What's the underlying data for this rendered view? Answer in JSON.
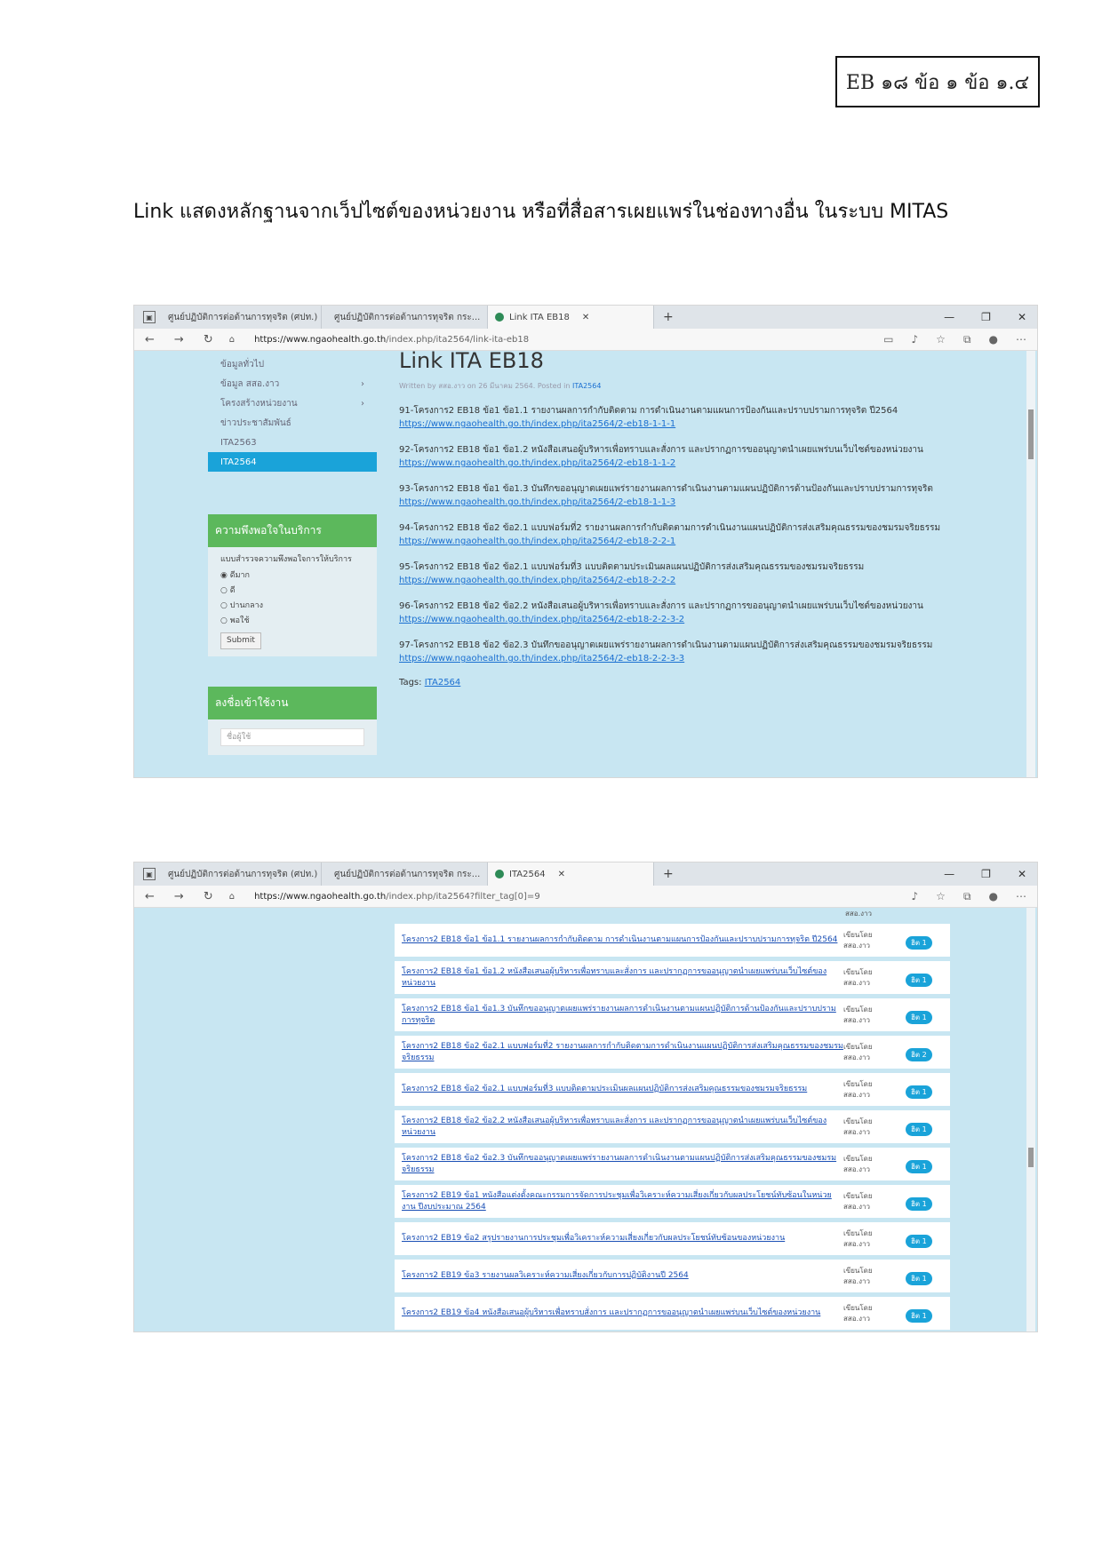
{
  "doc": {
    "ref_box": "EB ๑๘ ข้อ ๑ ข้อ ๑.๔",
    "heading": "Link แสดงหลักฐานจากเว็ปไซต์ของหน่วยงาน หรือที่สื่อสารเผยแพร่ในช่องทางอื่น ในระบบ MITAS"
  },
  "shot1": {
    "tabs": [
      {
        "label": "ศูนย์ปฏิบัติการต่อต้านการทุจริต (ศปท.)"
      },
      {
        "label": "ศูนย์ปฏิบัติการต่อต้านการทุจริต กระ..."
      },
      {
        "label": "Link ITA EB18"
      }
    ],
    "url_host": "https://www.ngaohealth.go.th",
    "url_path": "/index.php/ita2564/link-ita-eb18",
    "sidebar": [
      {
        "label": "ข้อมูลทั่วไป",
        "arrow": ""
      },
      {
        "label": "ข้อมูล สสอ.งาว",
        "arrow": "›"
      },
      {
        "label": "โครงสร้างหน่วยงาน",
        "arrow": "›"
      },
      {
        "label": "ข่าวประชาสัมพันธ์",
        "arrow": ""
      },
      {
        "label": "ITA2563",
        "arrow": ""
      },
      {
        "label": "ITA2564",
        "arrow": ""
      }
    ],
    "survey": {
      "title": "ความพึงพอใจในบริการ",
      "question": "แบบสำรวจความพึงพอใจการให้บริการ",
      "options": [
        "ดีมาก",
        "ดี",
        "ปานกลาง",
        "พอใช้"
      ],
      "submit": "Submit"
    },
    "login": {
      "title": "ลงชื่อเข้าใช้งาน",
      "placeholder": "ชื่อผู้ใช้"
    },
    "page_title": "Link ITA EB18",
    "meta_prefix": "Written by สสอ.งาว on 26 มีนาคม 2564. Posted in",
    "meta_link": "ITA2564",
    "posts": [
      {
        "text": "91-โครงการ2 EB18 ข้อ1 ข้อ1.1 รายงานผลการกำกับติดตาม การดำเนินงานตามแผนการป้องกันและปราบปรามการทุจริต ปี2564",
        "link": "https://www.ngaohealth.go.th/index.php/ita2564/2-eb18-1-1-1"
      },
      {
        "text": "92-โครงการ2 EB18 ข้อ1 ข้อ1.2 หนังสือเสนอผู้บริหารเพื่อทราบและสั่งการ และปรากฏการขออนุญาตนำเผยแพร่บนเว็บไซต์ของหน่วยงาน",
        "link": "https://www.ngaohealth.go.th/index.php/ita2564/2-eb18-1-1-2"
      },
      {
        "text": "93-โครงการ2 EB18 ข้อ1 ข้อ1.3 บันทึกขออนุญาตเผยแพร่รายงานผลการดำเนินงานตามแผนปฏิบัติการด้านป้องกันและปราบปรามการทุจริต",
        "link": "https://www.ngaohealth.go.th/index.php/ita2564/2-eb18-1-1-3"
      },
      {
        "text": "94-โครงการ2 EB18 ข้อ2 ข้อ2.1 แบบฟอร์มที่2 รายงานผลการกำกับติดตามการดำเนินงานแผนปฏิบัติการส่งเสริมคุณธรรมของชมรมจริยธรรม",
        "link": "https://www.ngaohealth.go.th/index.php/ita2564/2-eb18-2-2-1"
      },
      {
        "text": "95-โครงการ2 EB18 ข้อ2 ข้อ2.1 แบบฟอร์มที่3 แบบติดตามประเมินผลแผนปฏิบัติการส่งเสริมคุณธรรมของชมรมจริยธรรม",
        "link": "https://www.ngaohealth.go.th/index.php/ita2564/2-eb18-2-2-2"
      },
      {
        "text": "96-โครงการ2 EB18 ข้อ2 ข้อ2.2 หนังสือเสนอผู้บริหารเพื่อทราบและสั่งการ และปรากฏการขออนุญาตนำเผยแพร่บนเว็บไซต์ของหน่วยงาน",
        "link": "https://www.ngaohealth.go.th/index.php/ita2564/2-eb18-2-2-3-2"
      },
      {
        "text": "97-โครงการ2 EB18 ข้อ2 ข้อ2.3 บันทึกขออนุญาตเผยแพร่รายงานผลการดำเนินงานตามแผนปฏิบัติการส่งเสริมคุณธรรมของชมรมจริยธรรม",
        "link": "https://www.ngaohealth.go.th/index.php/ita2564/2-eb18-2-2-3-3"
      }
    ],
    "tags_label": "Tags:",
    "tags_link": "ITA2564"
  },
  "shot2": {
    "tabs": [
      {
        "label": "ศูนย์ปฏิบัติการต่อต้านการทุจริต (ศปท.)"
      },
      {
        "label": "ศูนย์ปฏิบัติการต่อต้านการทุจริต กระ..."
      },
      {
        "label": "ITA2564"
      }
    ],
    "url_host": "https://www.ngaohealth.go.th",
    "url_path": "/index.php/ita2564?filter_tag[0]=9",
    "top_fragment": "สสอ.งาว",
    "rows": [
      {
        "title": "โครงการ2 EB18 ข้อ1 ข้อ1.1 รายงานผลการกำกับติดตาม การดำเนินงานตามแผนการป้องกันและปราบปรามการทุจริต ปี2564",
        "author_a": "เขียนโดย",
        "author_b": "สสอ.งาว",
        "badge": "ฮิต 1"
      },
      {
        "title": "โครงการ2 EB18 ข้อ1 ข้อ1.2 หนังสือเสนอผู้บริหารเพื่อทราบและสั่งการ และปรากฏการขออนุญาตนำเผยแพร่บนเว็บไซต์ของหน่วยงาน",
        "author_a": "เขียนโดย",
        "author_b": "สสอ.งาว",
        "badge": "ฮิต 1"
      },
      {
        "title": "โครงการ2 EB18 ข้อ1 ข้อ1.3 บันทึกขออนุญาตเผยแพร่รายงานผลการดำเนินงานตามแผนปฏิบัติการด้านป้องกันและปราบปรามการทุจริต",
        "author_a": "เขียนโดย",
        "author_b": "สสอ.งาว",
        "badge": "ฮิต 1"
      },
      {
        "title": "โครงการ2 EB18 ข้อ2 ข้อ2.1 แบบฟอร์มที่2 รายงานผลการกำกับติดตามการดำเนินงานแผนปฏิบัติการส่งเสริมคุณธรรมของชมรมจริยธรรม",
        "author_a": "เขียนโดย",
        "author_b": "สสอ.งาว",
        "badge": "ฮิต 2"
      },
      {
        "title": "โครงการ2 EB18 ข้อ2 ข้อ2.1 แบบฟอร์มที่3 แบบติดตามประเมินผลแผนปฏิบัติการส่งเสริมคุณธรรมของชมรมจริยธรรม",
        "author_a": "เขียนโดย",
        "author_b": "สสอ.งาว",
        "badge": "ฮิต 1"
      },
      {
        "title": "โครงการ2 EB18 ข้อ2 ข้อ2.2 หนังสือเสนอผู้บริหารเพื่อทราบและสั่งการ และปรากฏการขออนุญาตนำเผยแพร่บนเว็บไซต์ของหน่วยงาน",
        "author_a": "เขียนโดย",
        "author_b": "สสอ.งาว",
        "badge": "ฮิต 1"
      },
      {
        "title": "โครงการ2 EB18 ข้อ2 ข้อ2.3 บันทึกขออนุญาตเผยแพร่รายงานผลการดำเนินงานตามแผนปฏิบัติการส่งเสริมคุณธรรมของชมรมจริยธรรม",
        "author_a": "เขียนโดย",
        "author_b": "สสอ.งาว",
        "badge": "ฮิต 1"
      },
      {
        "title": "โครงการ2 EB19 ข้อ1 หนังสือแต่งตั้งคณะกรรมการจัดการประชุมเพื่อวิเคราะห์ความเสี่ยงเกี่ยวกับผลประโยชน์ทับซ้อนในหน่วยงาน ปีงบประมาณ 2564",
        "author_a": "เขียนโดย",
        "author_b": "สสอ.งาว",
        "badge": "ฮิต 1"
      },
      {
        "title": "โครงการ2 EB19 ข้อ2 สรุปรายงานการประชุมเพื่อวิเคราะห์ความเสี่ยงเกี่ยวกับผลประโยชน์ทับซ้อนของหน่วยงาน",
        "author_a": "เขียนโดย",
        "author_b": "สสอ.งาว",
        "badge": "ฮิต 1"
      },
      {
        "title": "โครงการ2 EB19 ข้อ3 รายงานผลวิเคราะห์ความเสี่ยงเกี่ยวกับการปฏิบัติงานปี 2564",
        "author_a": "เขียนโดย",
        "author_b": "สสอ.งาว",
        "badge": "ฮิต 1"
      },
      {
        "title": "โครงการ2 EB19 ข้อ4 หนังสือเสนอผู้บริหารเพื่อทราบสั่งการ และปรากฏการขออนุญาตนำเผยแพร่บนเว็บไซต์ของหน่วยงาน",
        "author_a": "เขียนโดย",
        "author_b": "สสอ.งาว",
        "badge": "ฮิต 1"
      }
    ]
  }
}
